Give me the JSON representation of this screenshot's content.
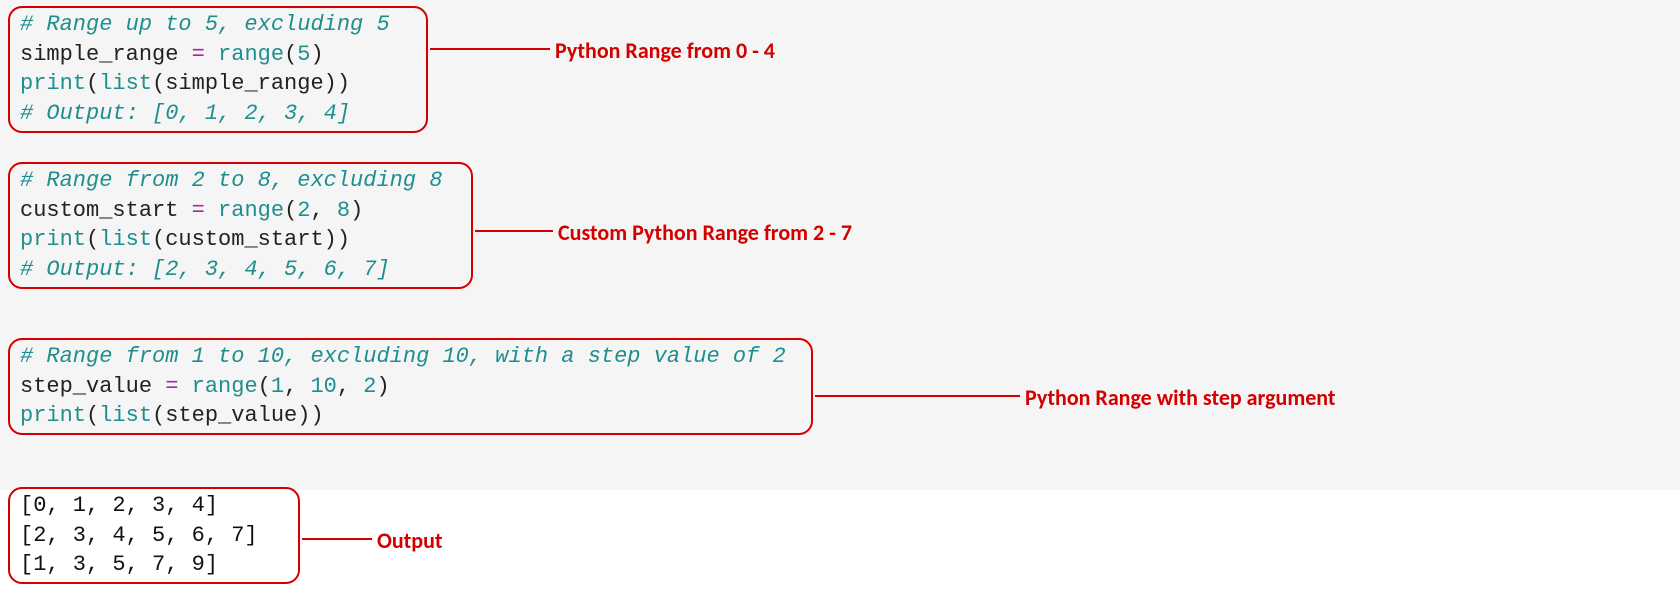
{
  "blocks": {
    "simple": {
      "comment": "# Range up to 5, excluding 5",
      "assign_var": "simple_range",
      "assign_call": "range(5)",
      "print_line": "print(list(simple_range))",
      "out_comment": "# Output: [0, 1, 2, 3, 4]",
      "label": "Python Range from 0 - 4"
    },
    "custom": {
      "comment": "# Range from 2 to 8, excluding 8",
      "assign_var": "custom_start",
      "assign_call": "range(2, 8)",
      "print_line": "print(list(custom_start))",
      "out_comment": "# Output: [2, 3, 4, 5, 6, 7]",
      "label": "Custom Python Range from 2 - 7"
    },
    "step": {
      "comment": "# Range from 1 to 10, excluding 10, with a step value of 2",
      "assign_var": "step_value",
      "assign_call": "range(1, 10, 2)",
      "print_line": "print(list(step_value))",
      "label": "Python Range with step argument"
    },
    "output": {
      "line1": "[0, 1, 2, 3, 4]",
      "line2": "[2, 3, 4, 5, 6, 7]",
      "line3": "[1, 3, 5, 7, 9]",
      "label": "Output"
    }
  }
}
